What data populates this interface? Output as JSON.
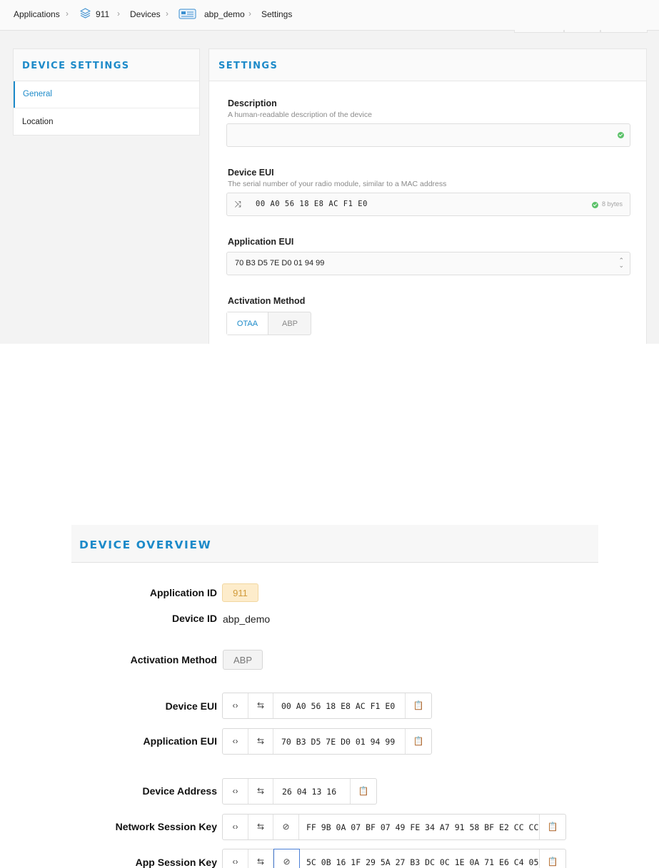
{
  "breadcrumb": {
    "applications": "Applications",
    "app_id": "911",
    "devices": "Devices",
    "device": "abp_demo",
    "settings": "Settings"
  },
  "sidebar": {
    "title": "DEVICE SETTINGS",
    "items": [
      {
        "label": "General",
        "active": true
      },
      {
        "label": "Location",
        "active": false
      }
    ]
  },
  "settings": {
    "title": "SETTINGS",
    "description": {
      "label": "Description",
      "hint": "A human-readable description of the device",
      "value": ""
    },
    "device_eui": {
      "label": "Device EUI",
      "hint": "The serial number of your radio module, similar to a MAC address",
      "value": "00 A0 56 18 E8 AC F1 E0",
      "size_note": "8 bytes"
    },
    "app_eui": {
      "label": "Application EUI",
      "value": "70 B3 D5 7E D0 01 94 99"
    },
    "activation": {
      "label": "Activation Method",
      "options": [
        "OTAA",
        "ABP"
      ],
      "selected": "OTAA"
    }
  },
  "overview": {
    "title": "DEVICE OVERVIEW",
    "app_id_label": "Application ID",
    "app_id": "911",
    "device_id_label": "Device ID",
    "device_id": "abp_demo",
    "activation_label": "Activation Method",
    "activation": "ABP",
    "device_eui_label": "Device EUI",
    "device_eui": "00 A0 56 18 E8 AC F1 E0",
    "app_eui_label": "Application EUI",
    "app_eui": "70 B3 D5 7E D0 01 94 99",
    "dev_addr_label": "Device Address",
    "dev_addr": "26 04 13 16",
    "nwk_skey_label": "Network Session Key",
    "nwk_skey": "FF 9B 0A 07 BF 07 49 FE 34 A7 91 58 BF E2 CC CC",
    "app_skey_label": "App Session Key",
    "app_skey": "5C 0B 16 1F 29 5A 27 B3 DC 0C 1E 0A 71 E6 C4 05"
  },
  "icons": {
    "code": "‹›",
    "swap": "⇆",
    "hide": "⊘",
    "copy": "📋",
    "shuffle": "⤨"
  },
  "colors": {
    "accent": "#1c8ac9",
    "ok": "#5cc26a",
    "badge_bg": "#fdeccb",
    "badge_text": "#d19a3a"
  }
}
